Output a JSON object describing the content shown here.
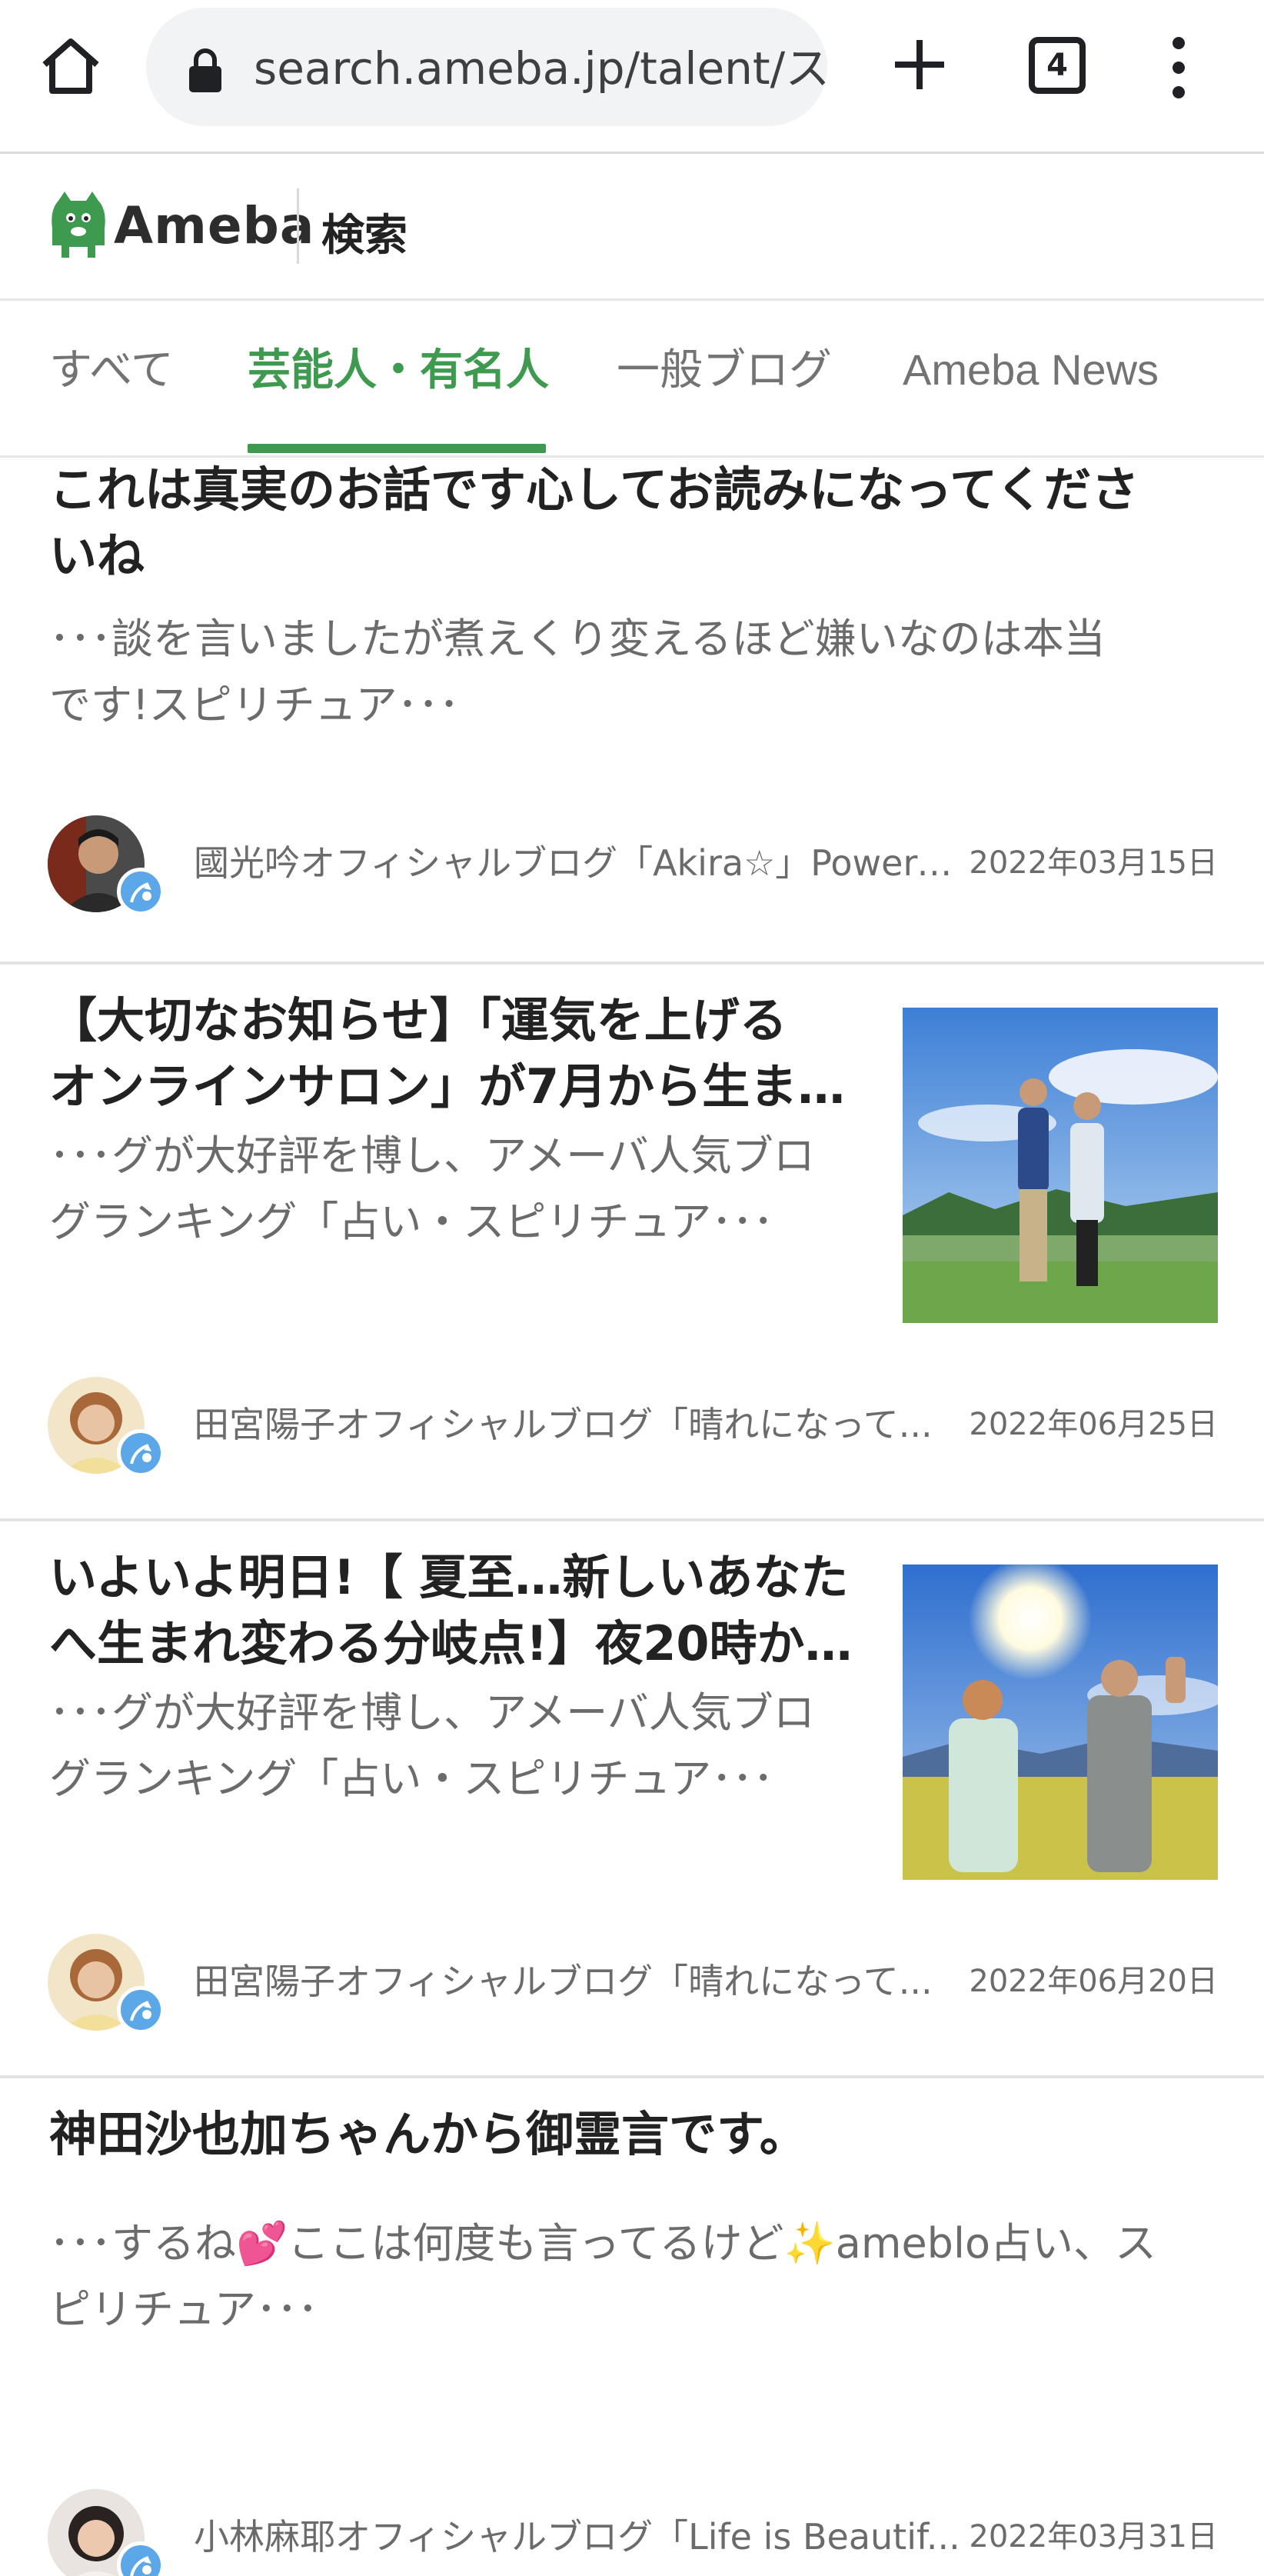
{
  "browser": {
    "url": "search.ameba.jp/talent/ス",
    "tab_count": "4",
    "icons": {
      "home": "home-icon",
      "lock": "lock-icon",
      "new_tab": "plus-icon",
      "tabs": "tabs-icon",
      "menu": "more-vert-icon"
    }
  },
  "header": {
    "logo_text": "Ameba",
    "title": "検索"
  },
  "tabs": [
    {
      "label": "すべて",
      "active": false
    },
    {
      "label": "芸能人・有名人",
      "active": true
    },
    {
      "label": "一般ブログ",
      "active": false
    },
    {
      "label": "Ameba News",
      "active": false
    }
  ],
  "colors": {
    "accent": "#3d9a4e",
    "badge": "#5ba7e8",
    "muted": "#6b6b6b"
  },
  "results": [
    {
      "title": "これは真実のお話です心してお読みになってください",
      "title_line1": "これは真実のお話です心してお読みになってくださ",
      "title_line2": "いね",
      "snippet_line1": "･･･談を言いましたが煮えくり変えるほど嫌いなのは本当",
      "snippet_line2": "です!スピリチュア･･･",
      "blog": "國光吟オフィシャルブログ「Akira☆」Powere...",
      "date": "2022年03月15日",
      "has_thumbnail": false
    },
    {
      "title_line1": "【大切なお知らせ】「運気を上げる",
      "title_line2": "オンラインサロン」が7月から生ま…",
      "snippet_line1": "･･･グが大好評を博し、アメーバ人気ブロ",
      "snippet_line2": "グランキング「占い・スピリチュア･･･",
      "blog": "田宮陽子オフィシャルブログ「晴れになって...",
      "date": "2022年06月25日",
      "has_thumbnail": true
    },
    {
      "title_line1": "いよいよ明日!【 夏至…新しいあなた",
      "title_line2": "へ生まれ変わる分岐点!】夜20時か…",
      "snippet_line1": "･･･グが大好評を博し、アメーバ人気ブロ",
      "snippet_line2": "グランキング「占い・スピリチュア･･･",
      "blog": "田宮陽子オフィシャルブログ「晴れになって...",
      "date": "2022年06月20日",
      "has_thumbnail": true
    },
    {
      "title_line1": "神田沙也加ちゃんから御霊言です。",
      "title_line2": "",
      "snippet_line1": "･･･するね💕ここは何度も言ってるけど✨ameblo占い、ス",
      "snippet_line2": "ピリチュア･･･",
      "blog": "小林麻耶オフィシャルブログ「Life is Beautif...",
      "date": "2022年03月31日",
      "has_thumbnail": false
    }
  ]
}
